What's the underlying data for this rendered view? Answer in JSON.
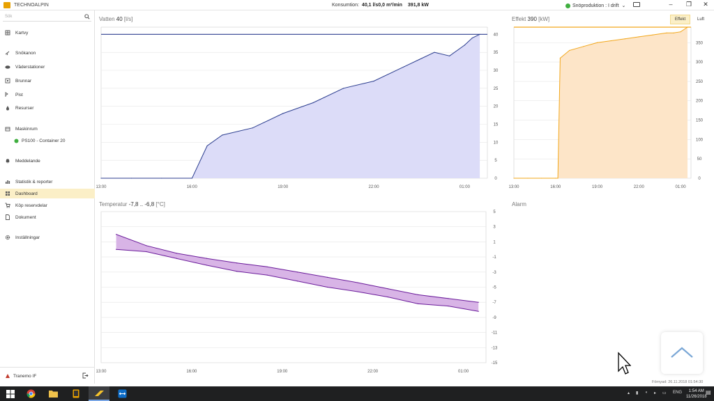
{
  "app": {
    "title": "TECHNOALPIN",
    "consumption_label": "Konsumtion:",
    "consumption_value": "40,1 l/s0,0 m³/min",
    "power_value": "391,8 kW",
    "production_status": "Snöproduktion : I drift",
    "window_controls": [
      "–",
      "❐",
      "✕"
    ]
  },
  "sidebar": {
    "search_placeholder": "Sök",
    "items": [
      {
        "label": "Kartvy",
        "icon": "map-icon"
      },
      {
        "label": "Snökanon",
        "icon": "snow-cannon-icon"
      },
      {
        "label": "Väderstationer",
        "icon": "weather-icon"
      },
      {
        "label": "Brunnar",
        "icon": "hydrant-icon"
      },
      {
        "label": "Pist",
        "icon": "slope-icon"
      },
      {
        "label": "Resurser",
        "icon": "drop-icon"
      },
      {
        "label": "Maskinrum",
        "icon": "machine-room-icon"
      },
      {
        "label": "PS100 - Container 20",
        "icon": "status-ok-icon"
      },
      {
        "label": "Meddelande",
        "icon": "bell-icon"
      },
      {
        "label": "Statistik & reporter",
        "icon": "statistics-icon"
      },
      {
        "label": "Dashboard",
        "icon": "dashboard-icon"
      },
      {
        "label": "Köp reservdelar",
        "icon": "cart-icon"
      },
      {
        "label": "Dokument",
        "icon": "document-icon"
      },
      {
        "label": "Inställningar",
        "icon": "gear-icon"
      }
    ],
    "club": "Tranemo IF"
  },
  "panels": {
    "water": {
      "title": "Vatten",
      "value": "40",
      "unit": "[l/s]"
    },
    "power": {
      "title": "Effekt",
      "value": "390",
      "unit": "[kW]",
      "tabs": [
        "Effekt",
        "Luft"
      ]
    },
    "temperature": {
      "title": "Temperatur",
      "value": "-7,8 .. -6,8",
      "unit": "[°C]"
    },
    "alarm": {
      "title": "Alarm"
    }
  },
  "footer": {
    "updated_label": "Förnyad:",
    "updated_value": "26.11.2018 01:54:30"
  },
  "taskbar": {
    "language": "ENG",
    "time": "1:54 AM",
    "date": "11/26/2018"
  },
  "colors": {
    "accent": "#f5c32c",
    "active_bg": "#fbefc7",
    "water_line": "#2c3e8f",
    "water_fill": "#dcdcf8",
    "power_line": "#f2a71b",
    "power_fill": "#fde5c8",
    "temp_line": "#6a1b9a",
    "temp_fill": "#d8b4e6"
  },
  "chart_data": [
    {
      "type": "area",
      "title": "Vatten 40 [l/s]",
      "x": [
        "13:00",
        "14:00",
        "15:00",
        "16:00",
        "16:30",
        "17:00",
        "18:00",
        "19:00",
        "20:00",
        "21:00",
        "22:00",
        "23:00",
        "23:30",
        "00:00",
        "00:30",
        "01:00",
        "01:15",
        "01:30"
      ],
      "series": [
        {
          "values": [
            0,
            0,
            0,
            0,
            9,
            12,
            14,
            18,
            21,
            25,
            27,
            31,
            33,
            35,
            34,
            37,
            39,
            40
          ]
        }
      ],
      "reference_line": 40,
      "ylim": [
        0,
        42
      ],
      "yticks": [
        0,
        5,
        10,
        15,
        20,
        25,
        30,
        35,
        40
      ],
      "xticks": [
        "13:00",
        "16:00",
        "19:00",
        "22:00",
        "01:00"
      ]
    },
    {
      "type": "area",
      "title": "Effekt 390 [kW]",
      "x": [
        "13:00",
        "14:00",
        "15:00",
        "16:00",
        "16:10",
        "16:20",
        "17:00",
        "18:00",
        "19:00",
        "20:00",
        "21:00",
        "22:00",
        "23:00",
        "00:00",
        "00:30",
        "01:00",
        "01:30"
      ],
      "series": [
        {
          "values": [
            0,
            0,
            0,
            0,
            0,
            310,
            330,
            340,
            350,
            355,
            360,
            365,
            370,
            375,
            375,
            378,
            390
          ]
        }
      ],
      "reference_line": 390,
      "ylim": [
        0,
        390
      ],
      "yticks": [
        0,
        50,
        100,
        150,
        200,
        250,
        300,
        350
      ],
      "xticks": [
        "13:00",
        "16:00",
        "19:00",
        "22:00",
        "01:00"
      ]
    },
    {
      "type": "area",
      "title": "Temperatur -7,8 .. -6,8 [°C]",
      "x": [
        "13:30",
        "14:30",
        "15:30",
        "16:30",
        "17:30",
        "18:30",
        "19:30",
        "20:30",
        "21:30",
        "22:30",
        "23:30",
        "00:30",
        "01:30"
      ],
      "series": [
        {
          "values": [
            2.0,
            0.5,
            -0.5,
            -1.2,
            -1.8,
            -2.3,
            -3.0,
            -3.7,
            -4.4,
            -5.2,
            -6.0,
            -6.5,
            -7.0
          ]
        },
        {
          "values": [
            -0.0,
            -0.3,
            -1.2,
            -2.1,
            -2.9,
            -3.4,
            -4.2,
            -5.0,
            -5.6,
            -6.3,
            -7.2,
            -7.5,
            -8.2
          ]
        }
      ],
      "ylim": [
        -15,
        5
      ],
      "yticks": [
        5,
        3,
        1,
        -1,
        -3,
        -5,
        -7,
        -9,
        -11,
        -13,
        -15
      ],
      "xticks": [
        "13:00",
        "16:00",
        "19:00",
        "22:00",
        "01:00"
      ]
    }
  ]
}
